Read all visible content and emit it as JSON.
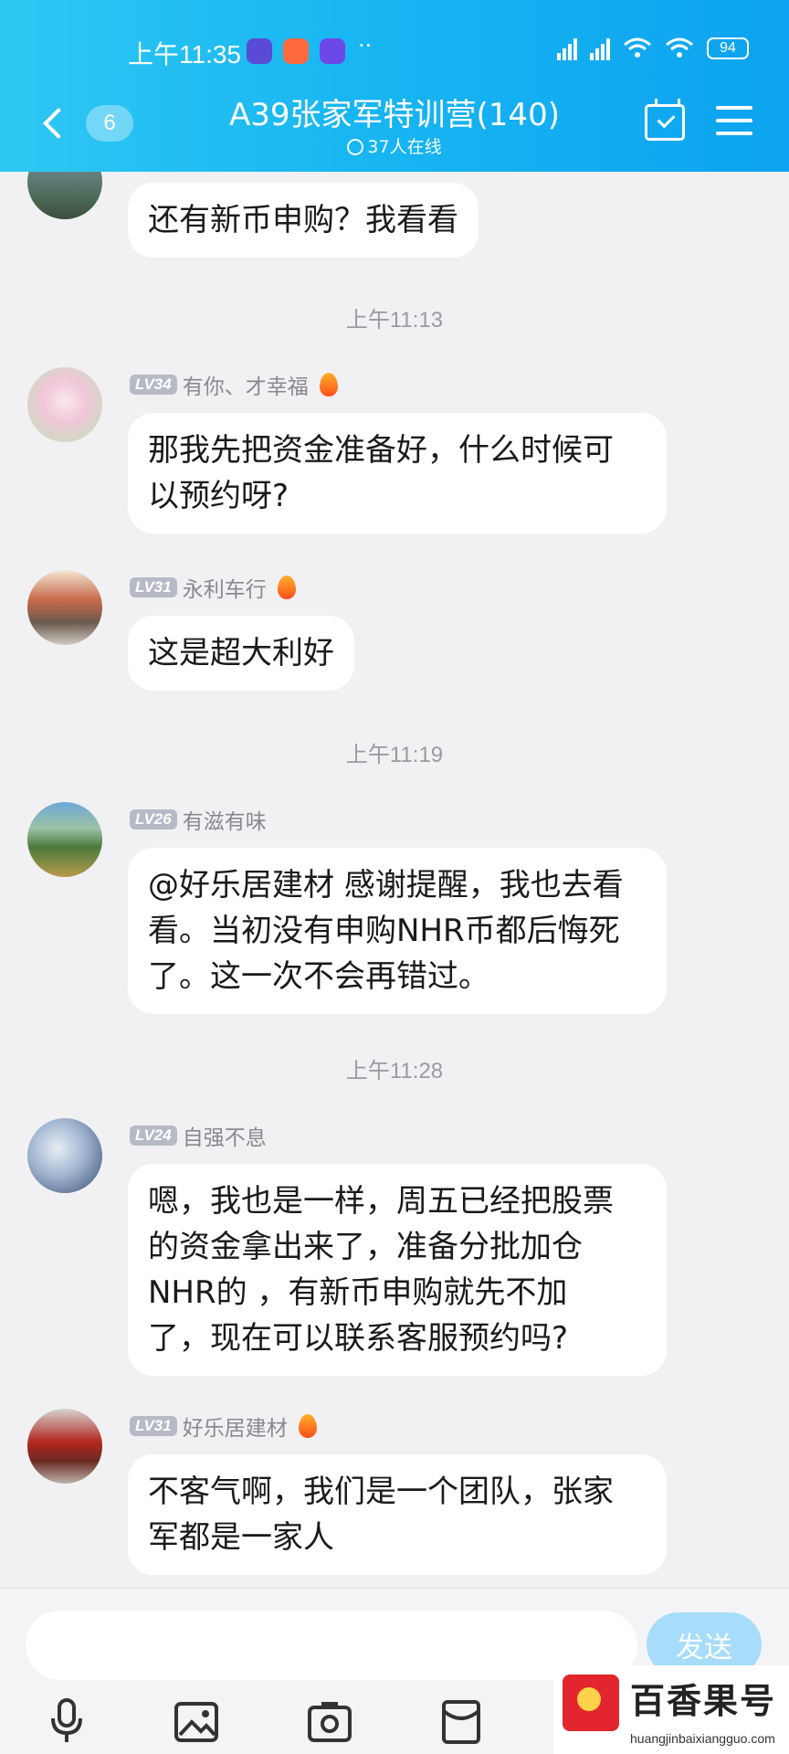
{
  "status_bar": {
    "time": "上午11:35",
    "dots": "··",
    "battery": "94"
  },
  "header": {
    "back_badge": "6",
    "title": "A39张家军特训营(140)",
    "online": "37人在线"
  },
  "chat": {
    "messages": [
      {
        "text": "还有新币申购？我看看"
      },
      {
        "time": "上午11:13"
      },
      {
        "level": "LV34",
        "name": "有你、才幸福",
        "line1": "那我先把资金准备好，什么时候可",
        "line2": "以预约呀?"
      },
      {
        "level": "LV31",
        "name": "永利车行",
        "text": "这是超大利好"
      },
      {
        "time": "上午11:19"
      },
      {
        "level": "LV26",
        "name": "有滋有味",
        "line1": "@好乐居建材 感谢提醒，我也去看",
        "line2": "看。当初没有申购NHR币都后悔死",
        "line3": "了。这一次不会再错过。"
      },
      {
        "time": "上午11:28"
      },
      {
        "level": "LV24",
        "name": "自强不息",
        "line1": "嗯，我也是一样，周五已经把股票",
        "line2": "的资金拿出来了，准备分批加仓",
        "line3": "NHR的 ，有新币申购就先不加",
        "line4": "了，现在可以联系客服预约吗?"
      },
      {
        "level": "LV31",
        "name": "好乐居建材",
        "line1": "不客气啊，我们是一个团队，张家",
        "line2": "军都是一家人"
      }
    ]
  },
  "input": {
    "value": "",
    "send_label": "发送"
  },
  "watermark": {
    "title": "百香果号",
    "url": "huangjinbaixiangguo.com"
  },
  "colors": {
    "header_accent": "#0da3f0",
    "send_button": "#a7dcfa",
    "background": "#f1f1f3"
  }
}
